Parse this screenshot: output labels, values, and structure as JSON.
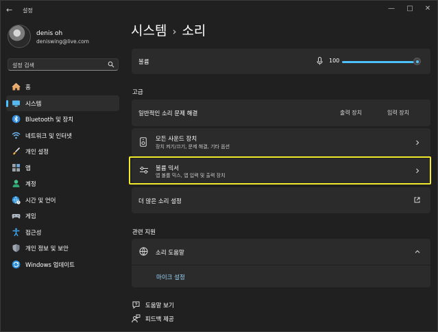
{
  "window": {
    "title": "설정"
  },
  "profile": {
    "name": "denis oh",
    "email": "deniswing@live.com"
  },
  "search": {
    "placeholder": "설정 검색"
  },
  "sidebar": {
    "items": [
      {
        "label": "홈",
        "icon": "home-icon"
      },
      {
        "label": "시스템",
        "icon": "monitor-icon",
        "active": true
      },
      {
        "label": "Bluetooth 및 장치",
        "icon": "bluetooth-icon"
      },
      {
        "label": "네트워크 및 인터넷",
        "icon": "wifi-icon"
      },
      {
        "label": "개인 설정",
        "icon": "brush-icon"
      },
      {
        "label": "앱",
        "icon": "apps-icon"
      },
      {
        "label": "계정",
        "icon": "person-icon"
      },
      {
        "label": "시간 및 언어",
        "icon": "globe-clock-icon"
      },
      {
        "label": "게임",
        "icon": "gamepad-icon"
      },
      {
        "label": "접근성",
        "icon": "accessibility-icon"
      },
      {
        "label": "개인 정보 및 보안",
        "icon": "shield-icon"
      },
      {
        "label": "Windows 업데이트",
        "icon": "update-icon"
      }
    ]
  },
  "header": {
    "breadcrumb_parent": "시스템",
    "breadcrumb_sep": "›",
    "breadcrumb_current": "소리"
  },
  "volume": {
    "label": "볼륨",
    "value": "100",
    "level": 1.0
  },
  "advanced": {
    "title": "고급",
    "troubleshoot": {
      "label": "일반적인 소리 문제 해결",
      "output_btn": "출력 장치",
      "input_btn": "입력 장치"
    },
    "all_devices": {
      "label": "모든 사운드 장치",
      "sub": "장치 켜기/끄기, 문제 해결, 기타 옵션"
    },
    "mixer": {
      "label": "볼륨 믹서",
      "sub": "앱 볼륨 믹스, 앱 입력 및 출력 장치"
    },
    "more": {
      "label": "더 많은 소리 설정"
    }
  },
  "related": {
    "title": "관련 지원",
    "sound_help": {
      "label": "소리 도움말"
    },
    "mic_setup": {
      "label": "마이크 설정"
    }
  },
  "help": {
    "get_help": "도움말 보기",
    "feedback": "피드백 제공"
  },
  "colors": {
    "accent": "#4cc2ff",
    "highlight": "#f2ea2c",
    "background": "#202020",
    "card": "#2b2b2b"
  }
}
